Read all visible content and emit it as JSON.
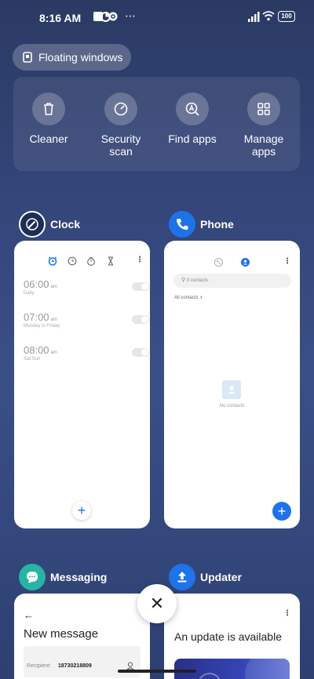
{
  "status_bar": {
    "time": "8:16 AM",
    "battery": "100",
    "overflow": "⋯"
  },
  "floating_windows": {
    "label": "Floating windows"
  },
  "tools": [
    {
      "label": "Cleaner",
      "icon": "trash-icon"
    },
    {
      "label": "Security scan",
      "icon": "shield-scan-icon"
    },
    {
      "label": "Find apps",
      "icon": "find-apps-icon"
    },
    {
      "label": "Manage apps",
      "icon": "grid-icon"
    }
  ],
  "apps": {
    "clock": {
      "name": "Clock",
      "accent": "#1e73e8",
      "alarms": [
        {
          "time": "06:00",
          "suffix": "am",
          "days": "Daily"
        },
        {
          "time": "07:00",
          "suffix": "am",
          "days": "Monday to Friday"
        },
        {
          "time": "08:00",
          "suffix": "am",
          "days": "Sat Sun"
        }
      ],
      "fab": "+"
    },
    "phone": {
      "name": "Phone",
      "accent": "#1e73e8",
      "search_placeholder": "0 contacts",
      "filter": "All contacts",
      "empty_text": "No contacts",
      "fab": "+"
    },
    "messaging": {
      "name": "Messaging",
      "accent": "#26b5a3",
      "title": "New message",
      "recipient_label": "Recipient:",
      "recipient_value": "18730218809",
      "back": "←"
    },
    "updater": {
      "name": "Updater",
      "accent": "#1e73e8",
      "title": "An update is available"
    }
  },
  "close_label": "✕",
  "colors": {
    "accent": "#1e73e8",
    "background_top": "#2b3a63",
    "background_bottom": "#2e3f70"
  }
}
